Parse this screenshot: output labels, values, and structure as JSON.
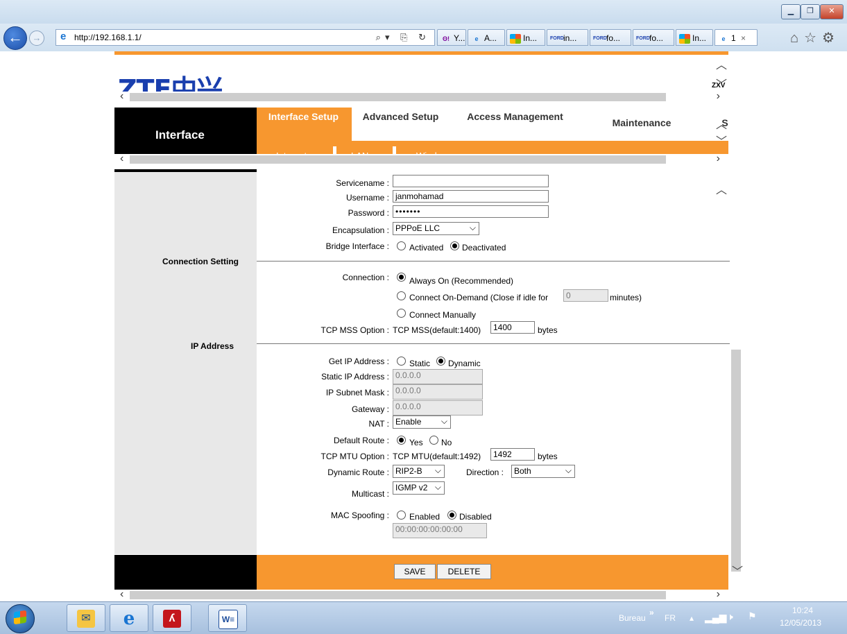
{
  "browser": {
    "url": "http://192.168.1.1/",
    "tabs": [
      {
        "icon": "yahoo-icon",
        "label": "Y..."
      },
      {
        "icon": "ie-icon",
        "label": "A..."
      },
      {
        "icon": "windows-icon",
        "label": "In..."
      },
      {
        "icon": "ford-icon",
        "label": "in..."
      },
      {
        "icon": "ford-icon",
        "label": "fo..."
      },
      {
        "icon": "ford-icon",
        "label": "fo..."
      },
      {
        "icon": "windows-icon",
        "label": "In..."
      },
      {
        "icon": "ie-icon",
        "label": "1"
      }
    ],
    "tab_close": "×"
  },
  "router": {
    "logo": "ZTE中兴",
    "corner_text": "ZXV",
    "section": "Interface",
    "menu": [
      "Interface Setup",
      "Advanced Setup",
      "Access Management",
      "Maintenance",
      "S"
    ],
    "submenu": [
      "Internet",
      "LAN",
      "Wireless"
    ],
    "form": {
      "servicename_label": "Servicename :",
      "servicename_value": "",
      "username_label": "Username :",
      "username_value": "janmohamad",
      "password_label": "Password :",
      "password_value": "•••••••",
      "encapsulation_label": "Encapsulation :",
      "encapsulation_value": "PPPoE LLC",
      "bridge_label": "Bridge Interface :",
      "bridge_options": [
        "Activated",
        "Deactivated"
      ],
      "bridge_selected": "Deactivated",
      "connection_setting_title": "Connection Setting",
      "connection_label": "Connection :",
      "connection_options": [
        "Always On (Recommended)",
        "Connect On-Demand (Close if idle for",
        "Connect Manually"
      ],
      "idle_value": "0",
      "idle_unit": "minutes)",
      "tcp_mss_label": "TCP MSS Option :",
      "tcp_mss_text": "TCP MSS(default:1400)",
      "tcp_mss_value": "1400",
      "bytes": "bytes",
      "ip_address_title": "IP Address",
      "get_ip_label": "Get IP Address :",
      "get_ip_options": [
        "Static",
        "Dynamic"
      ],
      "static_ip_label": "Static IP Address :",
      "static_ip_value": "0.0.0.0",
      "subnet_label": "IP Subnet Mask :",
      "subnet_value": "0.0.0.0",
      "gateway_label": "Gateway :",
      "gateway_value": "0.0.0.0",
      "nat_label": "NAT :",
      "nat_value": "Enable",
      "default_route_label": "Default Route :",
      "default_route_options": [
        "Yes",
        "No"
      ],
      "tcp_mtu_label": "TCP MTU Option :",
      "tcp_mtu_text": "TCP MTU(default:1492)",
      "tcp_mtu_value": "1492",
      "dynamic_route_label": "Dynamic Route :",
      "dynamic_route_value": "RIP2-B",
      "direction_label": "Direction :",
      "direction_value": "Both",
      "multicast_label": "Multicast :",
      "multicast_value": "IGMP v2",
      "mac_spoof_label": "MAC Spoofing :",
      "mac_spoof_options": [
        "Enabled",
        "Disabled"
      ],
      "mac_value": "00:00:00:00:00:00"
    },
    "buttons": {
      "save": "SAVE",
      "delete": "DELETE"
    }
  },
  "taskbar": {
    "bureau": "Bureau",
    "lang": "FR",
    "time": "10:24",
    "date": "12/05/2013"
  }
}
